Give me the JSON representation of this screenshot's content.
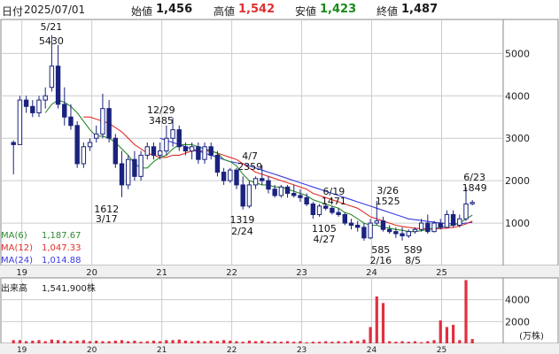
{
  "header": {
    "date_label": "日付",
    "date": "2025/07/01",
    "open_label": "始値",
    "open": "1,456",
    "high_label": "高値",
    "high": "1,542",
    "low_label": "安値",
    "low": "1,423",
    "close_label": "終値",
    "close": "1,487"
  },
  "colors": {
    "up": "#1a237e",
    "down": "#1a237e",
    "ma6": "#2e8b2e",
    "ma12": "#e0302a",
    "ma24": "#3a3ae0",
    "volume": "#e03040",
    "header_value": "#1a1a1a",
    "high_value": "#e03030",
    "low_value": "#1a8a1a"
  },
  "legend": {
    "ma6_name": "MA(6)",
    "ma6_value": "1,187.67",
    "ma12_name": "MA(12)",
    "ma12_value": "1,047.33",
    "ma24_name": "MA(24)",
    "ma24_value": "1,014.88",
    "volume_name": "出来高",
    "volume_value": "1,541,900株"
  },
  "annotations": [
    {
      "text": "5/21",
      "x": 2019.42
    },
    {
      "text": "5430",
      "x": 2019.42
    },
    {
      "text": "12/29",
      "x": 2020.99
    },
    {
      "text": "3485",
      "x": 2020.99
    },
    {
      "text": "1612",
      "x": 2020.21
    },
    {
      "text": "3/17",
      "x": 2020.21
    },
    {
      "text": "4/7",
      "x": 2022.26
    },
    {
      "text": "2359",
      "x": 2022.26
    },
    {
      "text": "1319",
      "x": 2022.15
    },
    {
      "text": "2/24",
      "x": 2022.15
    },
    {
      "text": "6/19",
      "x": 2023.46
    },
    {
      "text": "1471",
      "x": 2023.46
    },
    {
      "text": "1105",
      "x": 2023.32
    },
    {
      "text": "4/27",
      "x": 2023.32
    },
    {
      "text": "3/26",
      "x": 2024.23
    },
    {
      "text": "1525",
      "x": 2024.23
    },
    {
      "text": "585",
      "x": 2024.13
    },
    {
      "text": "2/16",
      "x": 2024.13
    },
    {
      "text": "589",
      "x": 2024.59
    },
    {
      "text": "8/5",
      "x": 2024.59
    },
    {
      "text": "6/23",
      "x": 2025.47
    },
    {
      "text": "1849",
      "x": 2025.47
    }
  ],
  "chart_data": {
    "type": "candlestick",
    "x_unit": "year",
    "x_ticks": [
      "19",
      "20",
      "21",
      "22",
      "23",
      "24",
      "25"
    ],
    "price_ticks": [
      1000,
      2000,
      3000,
      4000,
      5000
    ],
    "volume_ticks": [
      2000,
      4000
    ],
    "volume_unit": "(万株)",
    "price_ylim": [
      0,
      5800
    ],
    "volume_ylim": [
      0,
      6000
    ],
    "candles": [
      {
        "o": 2900,
        "h": 2950,
        "l": 2150,
        "c": 2850
      },
      {
        "o": 2850,
        "h": 4000,
        "l": 2850,
        "c": 3900
      },
      {
        "o": 3900,
        "h": 4000,
        "l": 3600,
        "c": 3750
      },
      {
        "o": 3750,
        "h": 3900,
        "l": 3500,
        "c": 3600
      },
      {
        "o": 3600,
        "h": 4000,
        "l": 3500,
        "c": 3900
      },
      {
        "o": 3900,
        "h": 4200,
        "l": 3700,
        "c": 4000
      },
      {
        "o": 4200,
        "h": 5430,
        "l": 4100,
        "c": 4700
      },
      {
        "o": 4700,
        "h": 5200,
        "l": 3700,
        "c": 3800
      },
      {
        "o": 3800,
        "h": 4200,
        "l": 3300,
        "c": 3500
      },
      {
        "o": 3500,
        "h": 3800,
        "l": 3200,
        "c": 3300
      },
      {
        "o": 3300,
        "h": 3400,
        "l": 2300,
        "c": 2400
      },
      {
        "o": 2400,
        "h": 2900,
        "l": 2300,
        "c": 2800
      },
      {
        "o": 2800,
        "h": 3000,
        "l": 2700,
        "c": 2900
      },
      {
        "o": 3000,
        "h": 3300,
        "l": 2900,
        "c": 3100
      },
      {
        "o": 3100,
        "h": 4050,
        "l": 3000,
        "c": 3700
      },
      {
        "o": 3700,
        "h": 3900,
        "l": 2900,
        "c": 3000
      },
      {
        "o": 3000,
        "h": 3100,
        "l": 2300,
        "c": 2400
      },
      {
        "o": 2400,
        "h": 2700,
        "l": 1612,
        "c": 1900
      },
      {
        "o": 1900,
        "h": 2600,
        "l": 1800,
        "c": 2500
      },
      {
        "o": 2500,
        "h": 2700,
        "l": 2000,
        "c": 2100
      },
      {
        "o": 2100,
        "h": 2700,
        "l": 2000,
        "c": 2600
      },
      {
        "o": 2600,
        "h": 2900,
        "l": 2500,
        "c": 2800
      },
      {
        "o": 2800,
        "h": 2900,
        "l": 2500,
        "c": 2600
      },
      {
        "o": 2600,
        "h": 2900,
        "l": 2500,
        "c": 2700
      },
      {
        "o": 2700,
        "h": 3300,
        "l": 2600,
        "c": 3000
      },
      {
        "o": 3000,
        "h": 3485,
        "l": 2800,
        "c": 3200
      },
      {
        "o": 3200,
        "h": 3300,
        "l": 2700,
        "c": 2800
      },
      {
        "o": 2800,
        "h": 2900,
        "l": 2600,
        "c": 2700
      },
      {
        "o": 2700,
        "h": 2900,
        "l": 2500,
        "c": 2800
      },
      {
        "o": 2800,
        "h": 2900,
        "l": 2400,
        "c": 2500
      },
      {
        "o": 2500,
        "h": 2900,
        "l": 2400,
        "c": 2800
      },
      {
        "o": 2800,
        "h": 2900,
        "l": 2500,
        "c": 2600
      },
      {
        "o": 2600,
        "h": 2700,
        "l": 2100,
        "c": 2200
      },
      {
        "o": 2200,
        "h": 2300,
        "l": 1900,
        "c": 2000
      },
      {
        "o": 2000,
        "h": 2300,
        "l": 1950,
        "c": 2250
      },
      {
        "o": 2250,
        "h": 2300,
        "l": 1800,
        "c": 1900
      },
      {
        "o": 1900,
        "h": 2100,
        "l": 1319,
        "c": 1400
      },
      {
        "o": 1400,
        "h": 2000,
        "l": 1350,
        "c": 1900
      },
      {
        "o": 1900,
        "h": 2100,
        "l": 1800,
        "c": 2050
      },
      {
        "o": 2050,
        "h": 2359,
        "l": 1900,
        "c": 2000
      },
      {
        "o": 2000,
        "h": 2100,
        "l": 1700,
        "c": 1800
      },
      {
        "o": 1800,
        "h": 1900,
        "l": 1600,
        "c": 1650
      },
      {
        "o": 1650,
        "h": 1900,
        "l": 1600,
        "c": 1850
      },
      {
        "o": 1850,
        "h": 1900,
        "l": 1600,
        "c": 1700
      },
      {
        "o": 1700,
        "h": 1900,
        "l": 1600,
        "c": 1650
      },
      {
        "o": 1650,
        "h": 1800,
        "l": 1500,
        "c": 1600
      },
      {
        "o": 1600,
        "h": 1700,
        "l": 1400,
        "c": 1450
      },
      {
        "o": 1450,
        "h": 1500,
        "l": 1105,
        "c": 1200
      },
      {
        "o": 1200,
        "h": 1450,
        "l": 1150,
        "c": 1400
      },
      {
        "o": 1400,
        "h": 1471,
        "l": 1300,
        "c": 1350
      },
      {
        "o": 1350,
        "h": 1400,
        "l": 1200,
        "c": 1250
      },
      {
        "o": 1250,
        "h": 1350,
        "l": 1150,
        "c": 1200
      },
      {
        "o": 1200,
        "h": 1250,
        "l": 950,
        "c": 1000
      },
      {
        "o": 1000,
        "h": 1100,
        "l": 850,
        "c": 950
      },
      {
        "o": 950,
        "h": 1050,
        "l": 800,
        "c": 900
      },
      {
        "o": 900,
        "h": 1000,
        "l": 585,
        "c": 650
      },
      {
        "o": 650,
        "h": 1100,
        "l": 620,
        "c": 1000
      },
      {
        "o": 1000,
        "h": 1525,
        "l": 950,
        "c": 1050
      },
      {
        "o": 1050,
        "h": 1150,
        "l": 800,
        "c": 850
      },
      {
        "o": 850,
        "h": 950,
        "l": 750,
        "c": 800
      },
      {
        "o": 800,
        "h": 900,
        "l": 650,
        "c": 750
      },
      {
        "o": 750,
        "h": 900,
        "l": 589,
        "c": 700
      },
      {
        "o": 700,
        "h": 850,
        "l": 650,
        "c": 800
      },
      {
        "o": 800,
        "h": 900,
        "l": 750,
        "c": 850
      },
      {
        "o": 850,
        "h": 1100,
        "l": 800,
        "c": 1000
      },
      {
        "o": 1000,
        "h": 1200,
        "l": 750,
        "c": 800
      },
      {
        "o": 800,
        "h": 1050,
        "l": 780,
        "c": 1000
      },
      {
        "o": 1000,
        "h": 1100,
        "l": 850,
        "c": 900
      },
      {
        "o": 900,
        "h": 1300,
        "l": 880,
        "c": 1200
      },
      {
        "o": 1200,
        "h": 1300,
        "l": 900,
        "c": 950
      },
      {
        "o": 950,
        "h": 1200,
        "l": 900,
        "c": 1100
      },
      {
        "o": 1100,
        "h": 1849,
        "l": 1050,
        "c": 1450
      },
      {
        "o": 1456,
        "h": 1542,
        "l": 1423,
        "c": 1487
      }
    ],
    "candle_x_start": 2018.88,
    "candle_x_step": 0.0911,
    "ma6": [
      null,
      null,
      null,
      null,
      null,
      3600,
      3800,
      3900,
      3850,
      3750,
      3600,
      3400,
      3200,
      3050,
      3050,
      3000,
      2900,
      2750,
      2600,
      2400,
      2300,
      2300,
      2450,
      2550,
      2600,
      2750,
      2850,
      2850,
      2850,
      2800,
      2750,
      2700,
      2650,
      2500,
      2450,
      2350,
      2150,
      2000,
      1950,
      1900,
      1900,
      1850,
      1850,
      1800,
      1750,
      1700,
      1650,
      1550,
      1500,
      1450,
      1400,
      1350,
      1250,
      1200,
      1100,
      1000,
      950,
      950,
      900,
      880,
      850,
      830,
      800,
      800,
      820,
      850,
      880,
      900,
      930,
      950,
      1000,
      1100,
      1188
    ],
    "ma12": [
      null,
      null,
      null,
      null,
      null,
      null,
      null,
      null,
      null,
      null,
      null,
      3500,
      3500,
      3450,
      3400,
      3350,
      3250,
      3150,
      3000,
      2850,
      2750,
      2650,
      2600,
      2550,
      2550,
      2600,
      2600,
      2650,
      2700,
      2700,
      2700,
      2700,
      2650,
      2600,
      2550,
      2500,
      2400,
      2300,
      2200,
      2150,
      2100,
      2050,
      2000,
      1950,
      1900,
      1850,
      1800,
      1700,
      1650,
      1600,
      1550,
      1500,
      1450,
      1400,
      1350,
      1250,
      1150,
      1100,
      1050,
      1000,
      950,
      920,
      900,
      880,
      870,
      860,
      860,
      870,
      880,
      900,
      930,
      980,
      1047
    ],
    "ma24": [
      null,
      null,
      null,
      null,
      null,
      null,
      null,
      null,
      null,
      null,
      null,
      null,
      null,
      null,
      null,
      null,
      null,
      null,
      null,
      null,
      null,
      null,
      null,
      3000,
      2950,
      2900,
      2850,
      2800,
      2750,
      2700,
      2650,
      2600,
      2550,
      2500,
      2450,
      2420,
      2400,
      2350,
      2300,
      2250,
      2200,
      2150,
      2100,
      2050,
      2000,
      1950,
      1900,
      1850,
      1800,
      1750,
      1700,
      1650,
      1600,
      1550,
      1500,
      1450,
      1400,
      1350,
      1300,
      1250,
      1200,
      1150,
      1100,
      1080,
      1060,
      1040,
      1020,
      1000,
      990,
      980,
      985,
      1000,
      1015
    ],
    "volume": [
      300,
      300,
      200,
      250,
      300,
      200,
      350,
      300,
      250,
      200,
      250,
      300,
      200,
      250,
      200,
      200,
      250,
      300,
      200,
      250,
      150,
      200,
      250,
      200,
      300,
      300,
      350,
      250,
      200,
      250,
      200,
      250,
      200,
      300,
      250,
      200,
      150,
      250,
      200,
      250,
      150,
      200,
      150,
      200,
      150,
      200,
      100,
      150,
      150,
      200,
      150,
      200,
      150,
      250,
      200,
      350,
      1500,
      4300,
      3700,
      200,
      150,
      200,
      150,
      200,
      100,
      200,
      300,
      2100,
      1500,
      1700,
      300,
      5800,
      400
    ]
  }
}
